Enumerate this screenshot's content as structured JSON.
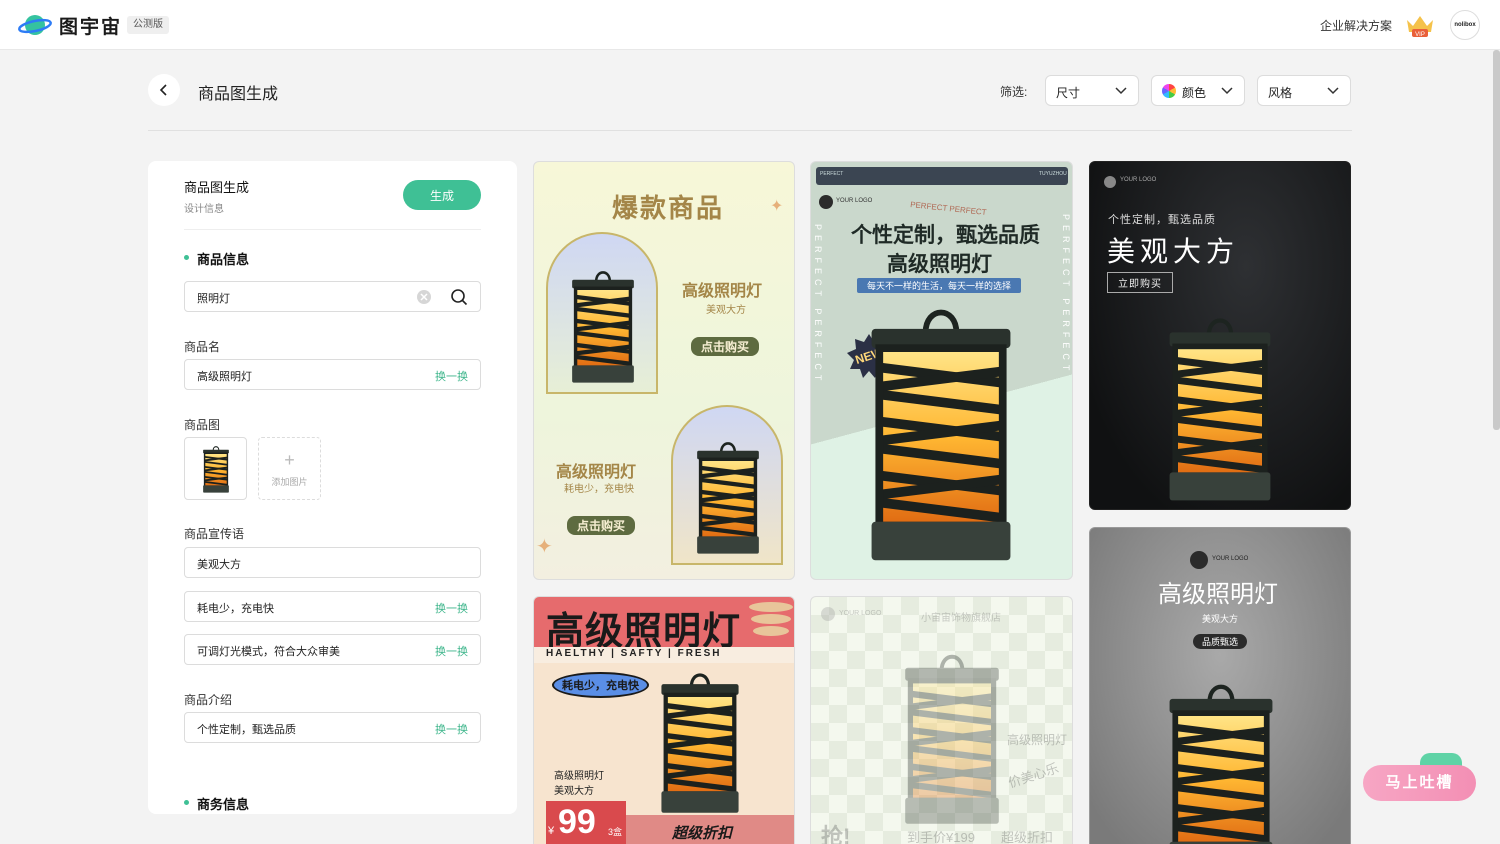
{
  "topbar": {
    "brand": "图宇宙",
    "beta": "公测版",
    "enterprise": "企业解决方案",
    "vip": "VIP",
    "avatar": "nolibox"
  },
  "header": {
    "title": "商品图生成",
    "filter_label": "筛选:",
    "filters": [
      {
        "label": "尺寸"
      },
      {
        "label": "颜色"
      },
      {
        "label": "风格"
      }
    ]
  },
  "panel": {
    "title": "商品图生成",
    "subtitle": "设计信息",
    "generate": "生成",
    "section_product": "商品信息",
    "search_value": "照明灯",
    "name_label": "商品名",
    "name_value": "高级照明灯",
    "swap": "换一换",
    "image_label": "商品图",
    "add_image": "添加图片",
    "slogan_label": "商品宣传语",
    "slogans": [
      "美观大方",
      "耗电少，充电快",
      "可调灯光模式，符合大众审美"
    ],
    "intro_label": "商品介绍",
    "intro_value": "个性定制，甄选品质",
    "section_business": "商务信息"
  },
  "cards": {
    "c1": {
      "headline": "爆款商品",
      "title_a": "高级照明灯",
      "sub_a": "美观大方",
      "btn_a": "点击购买",
      "title_b": "高级照明灯",
      "sub_b": "耗电少，充电快",
      "btn_b": "点击购买"
    },
    "c2": {
      "top_left": "PERFECT",
      "top_right": "TUYUZHOU",
      "logo": "YOUR LOGO",
      "arc": "PERFECT PERFECT",
      "title1": "个性定制，甄选品质",
      "title2": "高级照明灯",
      "tagline": "每天不一样的生活，每天一样的选择",
      "badge": "NEW",
      "side_left": "PERFECT PERFECT",
      "side_right": "PERFECT PERFECT"
    },
    "c3": {
      "logo": "YOUR LOGO",
      "small": "个性定制，甄选品质",
      "big": "美观大方",
      "btn": "立即购买"
    },
    "c4": {
      "title": "高级照明灯",
      "strip": "HAELTHY | SAFTY | FRESH",
      "pill": "耗电少，充电快",
      "line1": "高级照明灯",
      "line2": "美观大方",
      "currency": "¥",
      "price": "99",
      "unit": "3盒",
      "promo": "超级折扣"
    },
    "c5": {
      "logo": "YOUR LOGO",
      "store": "小宙宙饰物旗舰店",
      "side1": "高级照明灯",
      "side2": "价美心乐",
      "grab": "抢!",
      "price": "到手价¥199",
      "promo": "超级折扣"
    },
    "c6": {
      "logo": "YOUR LOGO",
      "title": "高级照明灯",
      "sub": "美观大方",
      "badge": "品质甄选"
    }
  },
  "feedback": "马上吐槽",
  "colors": {
    "accent": "#3fc095",
    "brand_blue": "#2d7cf6",
    "feedback_pink": "#f38fb4"
  }
}
